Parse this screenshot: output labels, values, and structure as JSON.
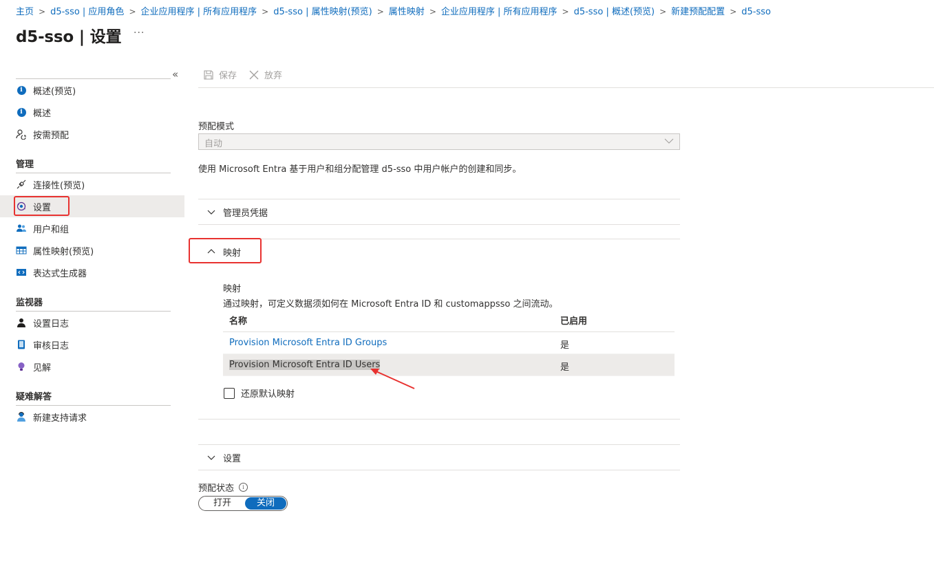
{
  "breadcrumb": [
    "主页",
    "d5-sso | 应用角色",
    "企业应用程序 | 所有应用程序",
    "d5-sso | 属性映射(预览)",
    "属性映射",
    "企业应用程序 | 所有应用程序",
    "d5-sso | 概述(预览)",
    "新建预配配置",
    "d5-sso"
  ],
  "page": {
    "title": "d5-sso | 设置",
    "more": "···"
  },
  "sidebar": {
    "collapse": "«",
    "items_top": [
      {
        "label": "概述(预览)",
        "icon": "info-icon"
      },
      {
        "label": "概述",
        "icon": "info-icon"
      },
      {
        "label": "按需预配",
        "icon": "person-sync-icon"
      }
    ],
    "section_manage": "管理",
    "items_manage": [
      {
        "label": "连接性(预览)",
        "icon": "plug-icon"
      },
      {
        "label": "设置",
        "icon": "gear-sync-icon"
      },
      {
        "label": "用户和组",
        "icon": "users-icon"
      },
      {
        "label": "属性映射(预览)",
        "icon": "table-icon"
      },
      {
        "label": "表达式生成器",
        "icon": "code-icon"
      }
    ],
    "section_monitor": "监视器",
    "items_monitor": [
      {
        "label": "设置日志",
        "icon": "person-log-icon"
      },
      {
        "label": "审核日志",
        "icon": "book-icon"
      },
      {
        "label": "见解",
        "icon": "lightbulb-icon"
      }
    ],
    "section_troubleshoot": "疑难解答",
    "items_troubleshoot": [
      {
        "label": "新建支持请求",
        "icon": "support-person-icon"
      }
    ]
  },
  "toolbar": {
    "save": "保存",
    "discard": "放弃"
  },
  "provisioning": {
    "mode_label": "预配模式",
    "mode_value": "自动",
    "description": "使用 Microsoft Entra 基于用户和组分配管理 d5-sso 中用户帐户的创建和同步。"
  },
  "sections": {
    "admin_credentials": "管理员凭据",
    "mappings": "映射",
    "settings": "设置"
  },
  "mappings": {
    "title": "映射",
    "description": "通过映射，可定义数据须如何在 Microsoft Entra ID 和 customappsso 之间流动。",
    "columns": [
      "名称",
      "已启用"
    ],
    "rows": [
      {
        "name": "Provision Microsoft Entra ID Groups",
        "enabled": "是"
      },
      {
        "name": "Provision Microsoft Entra ID Users",
        "enabled": "是"
      }
    ],
    "restore_default": "还原默认映射"
  },
  "provisioning_status": {
    "label": "预配状态",
    "on": "打开",
    "off": "关闭",
    "selected": "off"
  },
  "colors": {
    "accent": "#0f6cbd",
    "highlight": "#e8312f"
  }
}
